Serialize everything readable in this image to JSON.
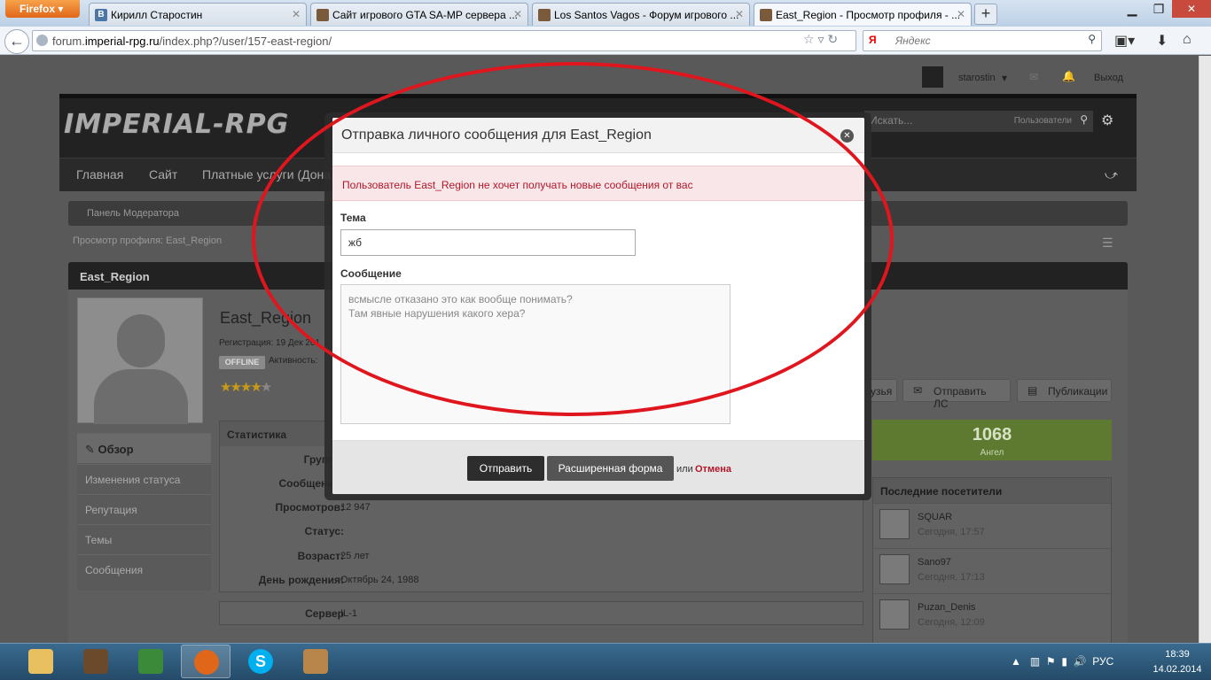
{
  "browser": {
    "app_button": "Firefox",
    "tabs": [
      {
        "title": "Кирилл Старостин",
        "favicon": "vk-icon"
      },
      {
        "title": "Сайт игрового GTA SA-MP сервера ...",
        "favicon": "gta-icon"
      },
      {
        "title": "Los Santos Vagos - Форум игрового ...",
        "favicon": "gta-icon"
      },
      {
        "title": "East_Region - Просмотр профиля - ...",
        "favicon": "gta-icon"
      }
    ],
    "url_prefix": "forum.",
    "url_domain": "imperial-rpg.ru",
    "url_path": "/index.php?/user/157-east-region/",
    "search_engine": "Я",
    "search_placeholder": "Яндекс"
  },
  "forum": {
    "logo": "IMPERIAL-RPG",
    "user": "starostin",
    "logout": "Выход",
    "search_placeholder": "Искать...",
    "search_scope": "Пользователи",
    "nav": [
      "Главная",
      "Сайт",
      "Платные услуги (Дона"
    ],
    "mod_panel": "Панель Модератора",
    "breadcrumb": "Просмотр профиля: East_Region",
    "profile_header": "East_Region"
  },
  "profile": {
    "name": "East_Region",
    "registered": "Регистрация: 19 Дек 201",
    "offline_badge": "OFFLINE",
    "activity": "Активность:",
    "rating_stars": 4,
    "side_nav": [
      {
        "label": "Обзор",
        "active": true
      },
      {
        "label": "Изменения статуса",
        "active": false
      },
      {
        "label": "Репутация",
        "active": false
      },
      {
        "label": "Темы",
        "active": false
      },
      {
        "label": "Сообщения",
        "active": false
      }
    ],
    "stats_title": "Статистика",
    "stats": [
      {
        "label": "Группа:",
        "value": ""
      },
      {
        "label": "Сообщений:",
        "value": ""
      },
      {
        "label": "Просмотров:",
        "value": "12 947"
      },
      {
        "label": "Статус:",
        "value": ""
      },
      {
        "label": "Возраст:",
        "value": "25 лет"
      },
      {
        "label": "День рождения:",
        "value": "Октябрь 24, 1988"
      }
    ],
    "server_label": "Сервер",
    "server_value": "IL-1",
    "buttons": [
      "узья",
      "Отправить ЛС",
      "Публикации"
    ],
    "rep_value": "1068",
    "rep_label": "Ангел",
    "visitors_title": "Последние посетители",
    "visitors": [
      {
        "name": "SQUAR",
        "time": "Сегодня, 17:57"
      },
      {
        "name": "Sano97",
        "time": "Сегодня, 17:13"
      },
      {
        "name": "Puzan_Denis",
        "time": "Сегодня, 12:09"
      }
    ]
  },
  "dialog": {
    "title": "Отправка личного сообщения для East_Region",
    "error": "Пользователь East_Region не хочет получать новые сообщения от вас",
    "subject_label": "Тема",
    "subject_value": "жб",
    "message_label": "Сообщение",
    "message_value": "всмысле отказано это как вообще понимать?\nТам явные нарушения какого хера?",
    "send": "Отправить",
    "extended": "Расширенная форма",
    "or": "или",
    "cancel": "Отмена"
  },
  "taskbar": {
    "language": "РУС",
    "time": "18:39",
    "date": "14.02.2014"
  },
  "colors": {
    "annotation": "#e0161e",
    "error_text": "#b0182a",
    "firefox": "#e0661a"
  }
}
